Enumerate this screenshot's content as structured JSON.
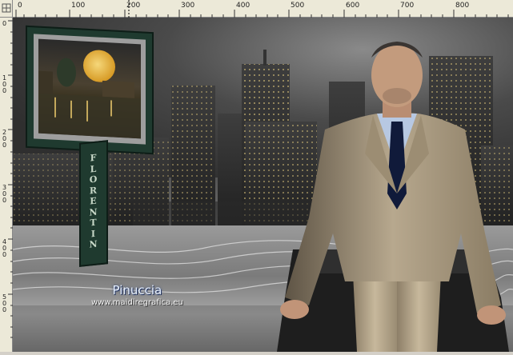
{
  "ruler": {
    "horizontal_labels": [
      "0",
      "100",
      "200",
      "300",
      "400",
      "500",
      "600",
      "700",
      "800"
    ],
    "vertical_labels": [
      "0",
      "1\n0\n0",
      "2\n0\n0",
      "3\n0\n0",
      "4\n0\n0",
      "5\n0\n0"
    ]
  },
  "billboard": {
    "pole_text": "FLORENTIN"
  },
  "watermark": {
    "name": "Pinuccia",
    "url": "www.maidiregrafica.eu"
  },
  "colors": {
    "billboard": "#1f3a2f",
    "ruler_bg": "#ece9d8",
    "watermark_text": "#e9f2ff"
  }
}
